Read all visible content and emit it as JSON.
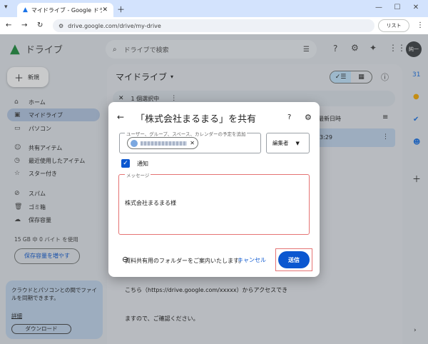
{
  "browser": {
    "tab_title": "マイドライブ - Google ドライブ",
    "url": "drive.google.com/drive/my-drive",
    "lens_label": "リスト"
  },
  "drive": {
    "app_name": "ドライブ",
    "search_placeholder": "ドライブで検索",
    "avatar_label": "純一",
    "new_button": "新規",
    "nav": [
      {
        "label": "ホーム",
        "icon": "home-icon"
      },
      {
        "label": "マイドライブ",
        "icon": "my-drive-icon"
      },
      {
        "label": "パソコン",
        "icon": "computer-icon"
      },
      {
        "label": "共有アイテム",
        "icon": "shared-icon"
      },
      {
        "label": "最近使用したアイテム",
        "icon": "recent-icon"
      },
      {
        "label": "スター付き",
        "icon": "star-icon"
      },
      {
        "label": "スパム",
        "icon": "spam-icon"
      },
      {
        "label": "ゴミ箱",
        "icon": "trash-icon"
      },
      {
        "label": "保存容量",
        "icon": "cloud-icon"
      }
    ],
    "storage_text": "15 GB 中 0 バイト を使用",
    "storage_button": "保存容量を増やす",
    "promo": {
      "text": "クラウドとパソコンとの間でファイルを同期できます。",
      "link": "詳細",
      "button": "ダウンロード"
    },
    "main_title": "マイドライブ",
    "selection_text": "1 個選択中",
    "column_header": "最新日時",
    "row_time": "3:29"
  },
  "dialog": {
    "title": "「株式会社まるまる」を共有",
    "people_label": "ユーザー、グループ、スペース、カレンダーの予定を追加",
    "role": "編集者",
    "notify_label": "通知",
    "message_label": "メッセージ",
    "message_lines": [
      "株式会社まるまる様",
      "",
      "資料共有用のフォルダーをご案内いたします。",
      "こちら（https://drive.google.com/xxxxx）からアクセスでき",
      "ますので、ご確認ください。"
    ],
    "cancel": "キャンセル",
    "send": "送信"
  }
}
